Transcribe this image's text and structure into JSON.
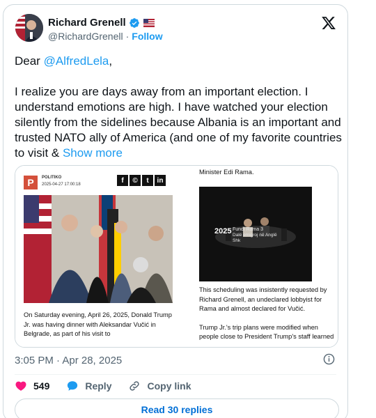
{
  "header": {
    "name": "Richard Grenell",
    "handle": "@RichardGrenell",
    "separator": "·",
    "follow_label": "Follow"
  },
  "tweet": {
    "greeting_prefix": "Dear ",
    "mention": "@AlfredLela",
    "greeting_suffix": ",",
    "body": "I realize you are days away from an important election. I understand emotions are high. I have watched your election silently from the sidelines because Albania is an important and trusted NATO ally of America (and one of my favorite countries to visit & ",
    "show_more": "Show more"
  },
  "media": {
    "logo_letter": "P",
    "source_name": "POLITIKO",
    "source_date": "2025-04-27 17:00:18",
    "share_icons": [
      "f",
      "©",
      "t",
      "in"
    ],
    "left_article": "On Saturday evening, April 26, 2025, Donald Trump Jr. was having dinner with Aleksandar Vučić in Belgrade, as part of his visit to",
    "right_top": "Minister Edi Rama.",
    "video_year": "2025",
    "video_line1": "Fundi Rama 3",
    "video_line2": "Dalë emigroj në Anglë",
    "video_line3": "Shk",
    "right_para1": "This scheduling was insistently requested by Richard Grenell, an undeclared lobbyist for Rama and almost declared for Vučić.",
    "right_para2": "Trump Jr.'s trip plans were modified when people close to President Trump's staff learned"
  },
  "timestamp": "3:05 PM · Apr 28, 2025",
  "actions": {
    "like_count": "549",
    "reply_label": "Reply",
    "copy_link_label": "Copy link"
  },
  "read_replies_label": "Read 30 replies",
  "colors": {
    "accent": "#1d9bf0",
    "like": "#f91880",
    "text": "#0f1419",
    "muted": "#536471"
  }
}
